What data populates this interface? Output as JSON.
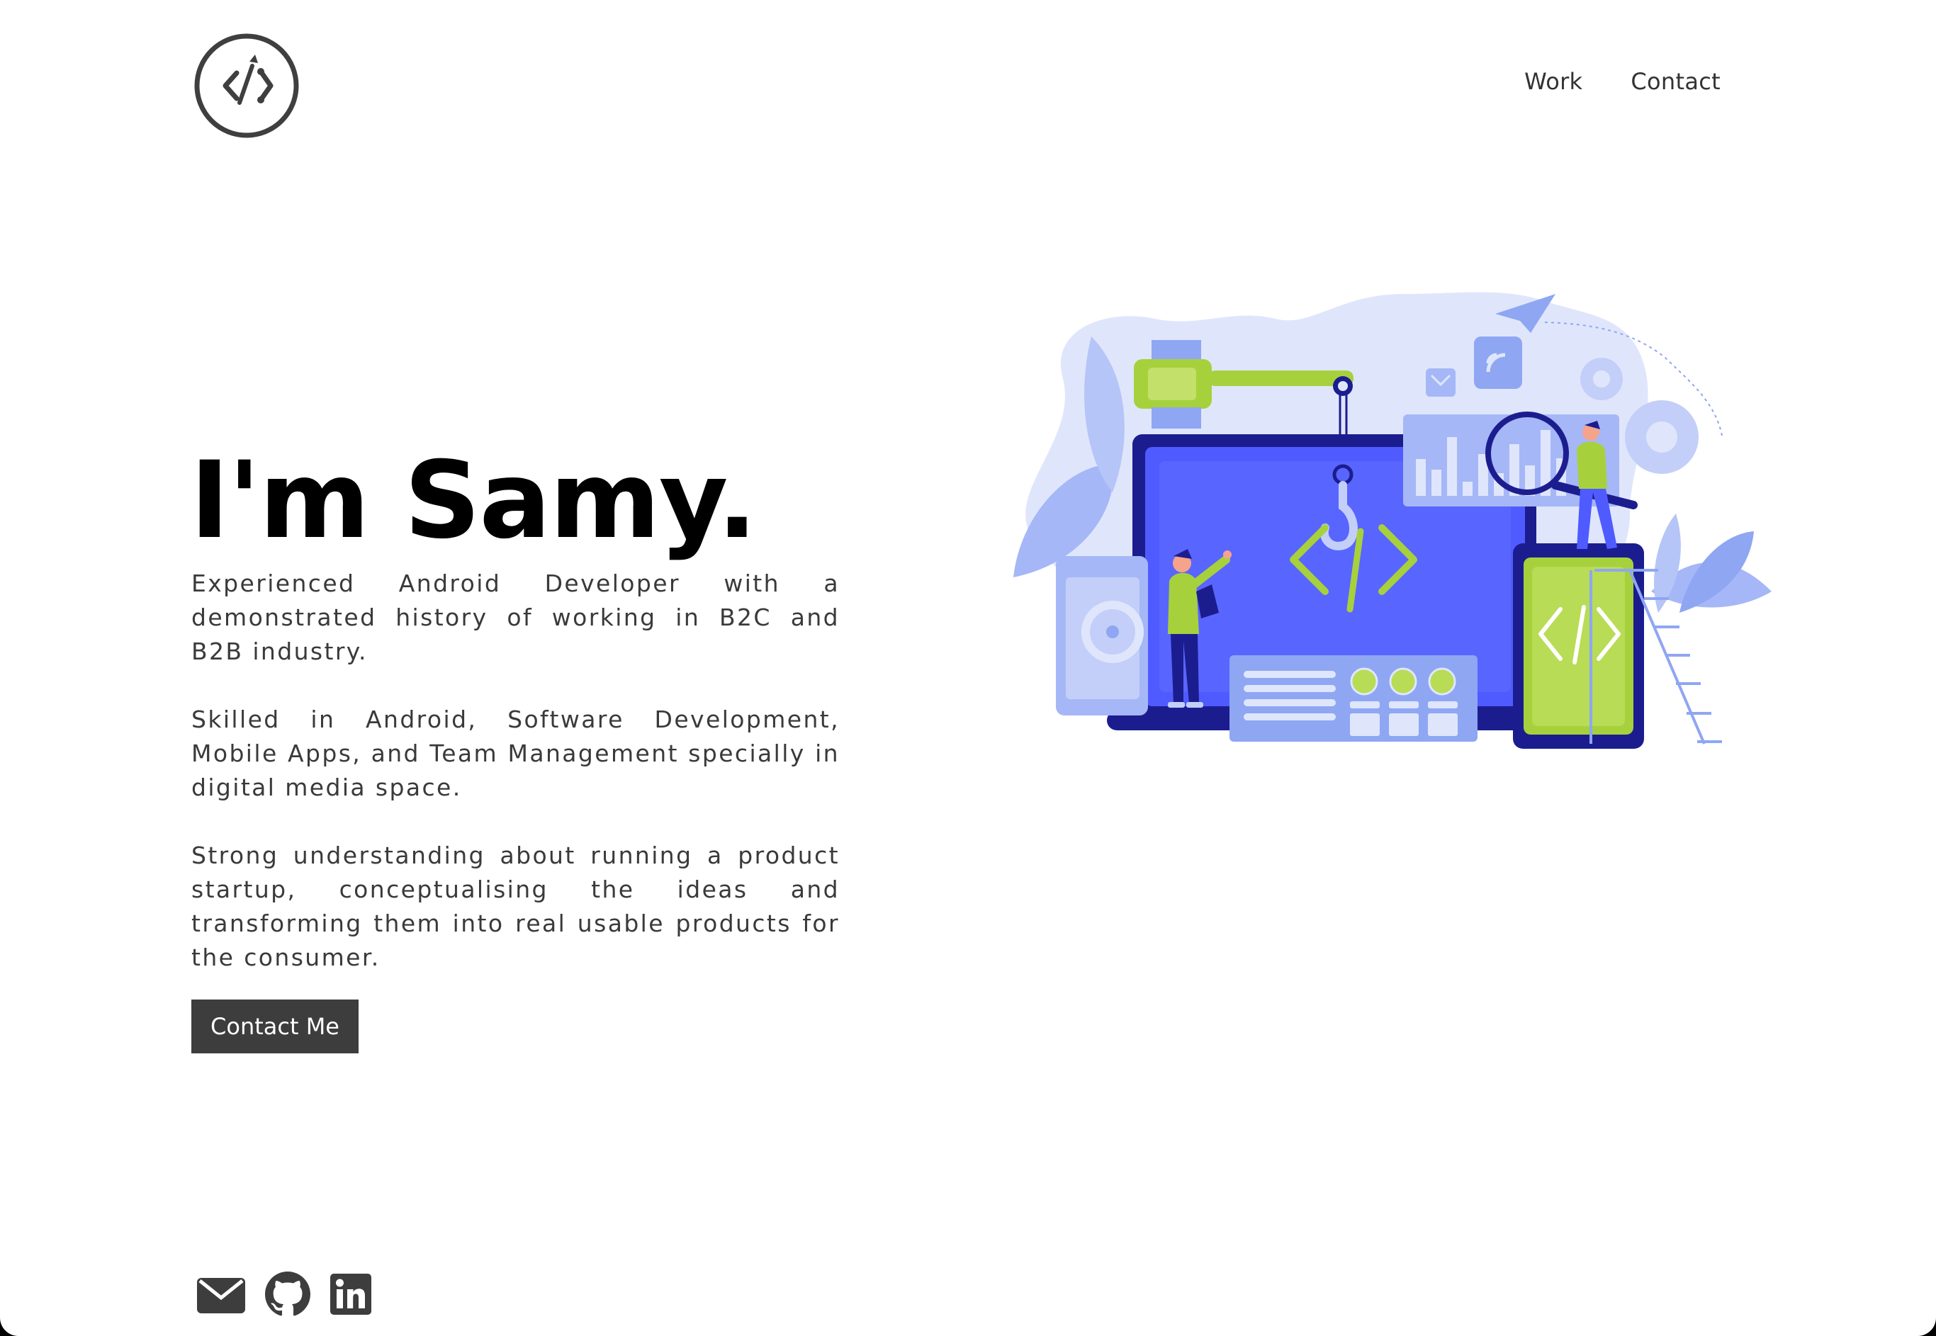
{
  "header": {
    "logo_icon": "code-pen-logo-icon",
    "nav": [
      {
        "label": "Work"
      },
      {
        "label": "Contact"
      }
    ]
  },
  "hero": {
    "title": "I'm Samy.",
    "paragraphs": [
      "Experienced Android Developer with a demonstrated history of working in B2C and B2B industry.",
      "Skilled in Android, Software Development, Mobile Apps, and Team Management specially in digital media space.",
      "Strong understanding about running a product startup, conceptualising the ideas and transforming them into real usable products for the consumer."
    ],
    "cta_label": "Contact Me"
  },
  "illustration": {
    "icon": "developer-illustration-icon",
    "code_symbol": "</>"
  },
  "social": [
    {
      "icon": "mail-icon"
    },
    {
      "icon": "github-icon"
    },
    {
      "icon": "linkedin-icon"
    }
  ],
  "colors": {
    "background": "#ffffff",
    "text": "#3b3b3b",
    "heading": "#000000",
    "button": "#3d3d3d",
    "illustration_blue": "#4f5bff",
    "illustration_green": "#a6d13c",
    "illustration_light": "#dfe6fc"
  }
}
